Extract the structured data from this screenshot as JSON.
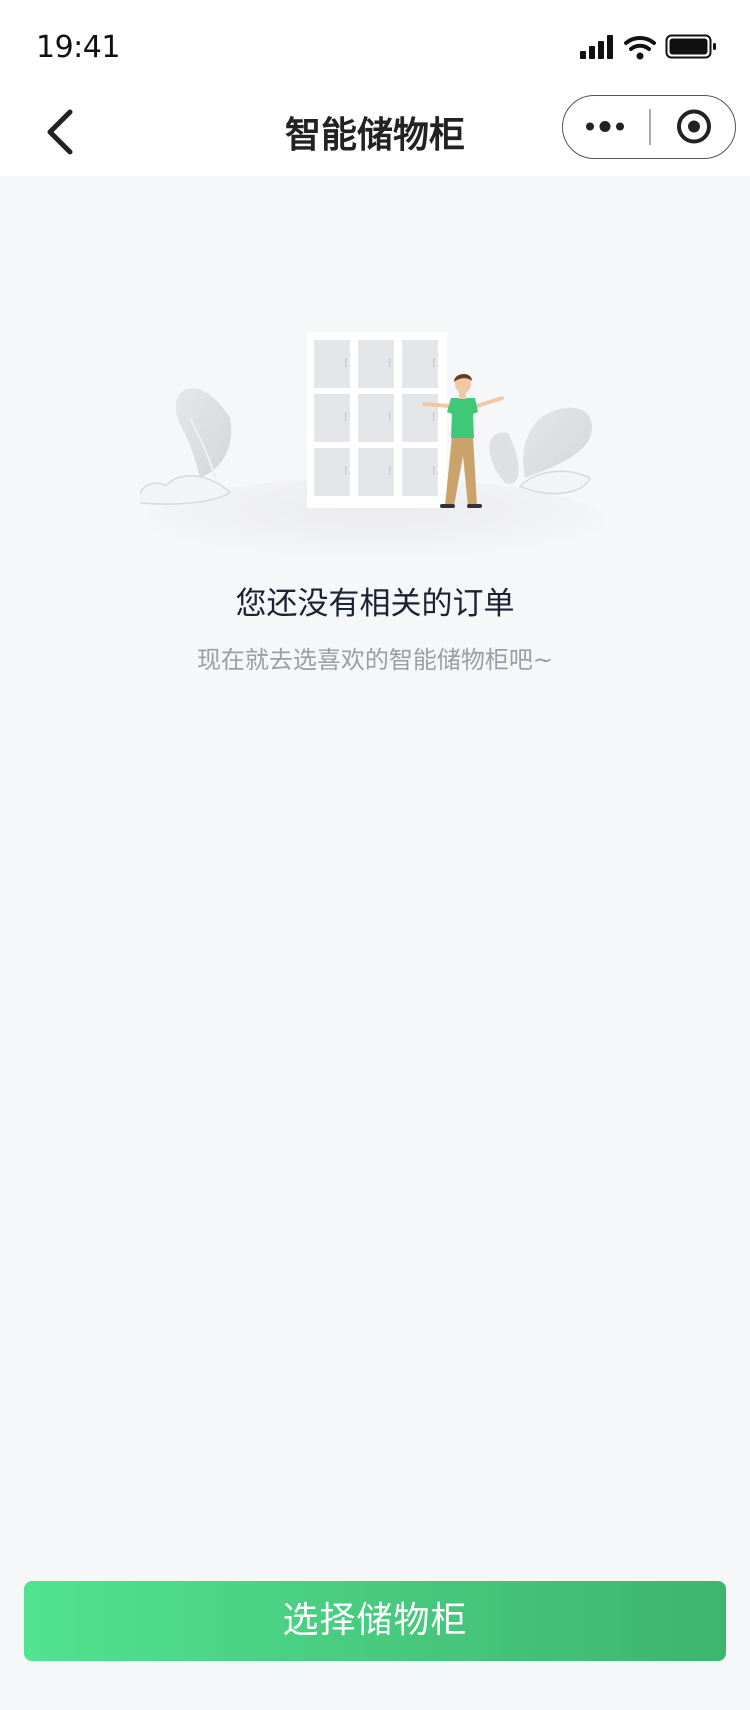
{
  "status_bar": {
    "time": "19:41"
  },
  "nav": {
    "title": "智能储物柜"
  },
  "empty_state": {
    "title": "您还没有相关的订单",
    "subtitle": "现在就去选喜欢的智能储物柜吧~"
  },
  "actions": {
    "select_locker_label": "选择储物柜"
  },
  "colors": {
    "accent": "#4cd887",
    "background": "#f6f7f9",
    "person_shirt": "#3fc878",
    "person_pants": "#c9a36a"
  },
  "icons": {
    "back": "chevron-left-icon",
    "more": "more-dots-icon",
    "close": "target-circle-icon",
    "signal": "signal-icon",
    "wifi": "wifi-icon",
    "battery": "battery-icon"
  }
}
